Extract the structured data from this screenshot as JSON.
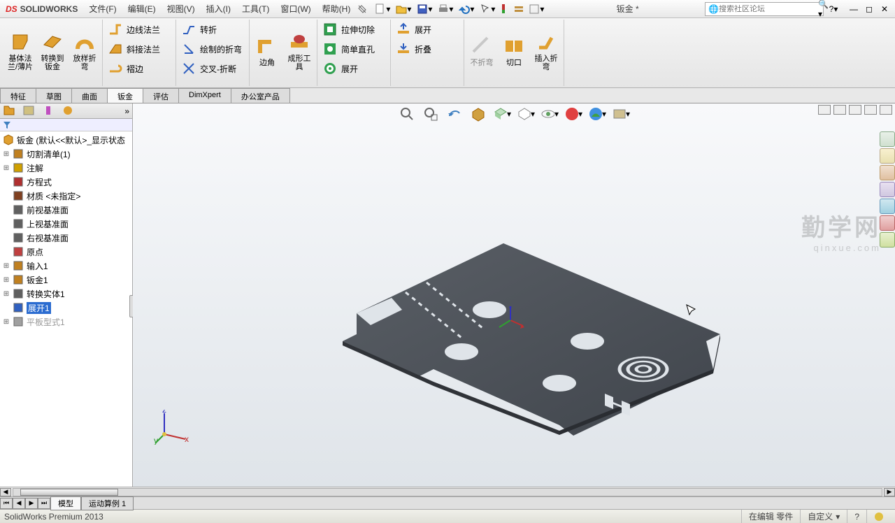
{
  "app": {
    "name": "SOLIDWORKS",
    "logo_prefix": "DS"
  },
  "menus": [
    "文件(F)",
    "编辑(E)",
    "视图(V)",
    "插入(I)",
    "工具(T)",
    "窗口(W)",
    "帮助(H)"
  ],
  "doc_name": "钣金 *",
  "search": {
    "placeholder": "搜索社区论坛"
  },
  "ribbon": {
    "big": [
      {
        "label": "基体法兰/薄片"
      },
      {
        "label": "转换到钣金"
      },
      {
        "label": "放样折弯"
      }
    ],
    "col2": [
      {
        "label": "边线法兰"
      },
      {
        "label": "斜接法兰"
      },
      {
        "label": "褶边"
      }
    ],
    "col3": [
      {
        "label": "转折"
      },
      {
        "label": "绘制的折弯"
      },
      {
        "label": "交叉-折断"
      }
    ],
    "big2": [
      {
        "label": "边角"
      },
      {
        "label": "成形工具"
      }
    ],
    "col4": [
      {
        "label": "拉伸切除"
      },
      {
        "label": "简单直孔"
      },
      {
        "label": "展开"
      }
    ],
    "col5": [
      {
        "label": "展开"
      },
      {
        "label": "折叠"
      }
    ],
    "big3": [
      {
        "label": "不折弯",
        "disabled": true
      },
      {
        "label": "切口"
      },
      {
        "label": "插入折弯"
      }
    ]
  },
  "cmd_tabs": [
    "特征",
    "草图",
    "曲面",
    "钣金",
    "评估",
    "DimXpert",
    "办公室产品"
  ],
  "cmd_active": "钣金",
  "tree": {
    "root": "钣金  (默认<<默认>_显示状态",
    "items": [
      {
        "label": "切割清单(1)",
        "exp": true,
        "icon": "cut-list-icon",
        "color": "#c08020"
      },
      {
        "label": "注解",
        "exp": true,
        "icon": "annotation-icon",
        "color": "#d0a000"
      },
      {
        "label": "方程式",
        "icon": "equation-icon",
        "color": "#b03030"
      },
      {
        "label": "材质 <未指定>",
        "icon": "material-icon",
        "color": "#804020"
      },
      {
        "label": "前视基准面",
        "icon": "plane-icon",
        "color": "#606060"
      },
      {
        "label": "上视基准面",
        "icon": "plane-icon",
        "color": "#606060"
      },
      {
        "label": "右视基准面",
        "icon": "plane-icon",
        "color": "#606060"
      },
      {
        "label": "原点",
        "icon": "origin-icon",
        "color": "#c04040"
      },
      {
        "label": "输入1",
        "exp": true,
        "icon": "import-icon",
        "color": "#c08020"
      },
      {
        "label": "钣金1",
        "exp": true,
        "icon": "sheetmetal-icon",
        "color": "#c08020"
      },
      {
        "label": "转换实体1",
        "exp": true,
        "icon": "convert-icon",
        "color": "#606060"
      },
      {
        "label": "展开1",
        "selected": true,
        "icon": "unfold-icon",
        "color": "#3060c0"
      },
      {
        "label": "平板型式1",
        "exp": true,
        "grey": true,
        "icon": "flatpattern-icon",
        "color": "#a0a0a0"
      }
    ]
  },
  "bottom_tabs": [
    "模型",
    "运动算例 1"
  ],
  "status": {
    "left": "SolidWorks Premium 2013",
    "edit": "在编辑 零件",
    "custom": "自定义"
  },
  "watermark": {
    "cn": "勤学网",
    "en": "qinxue.com"
  }
}
